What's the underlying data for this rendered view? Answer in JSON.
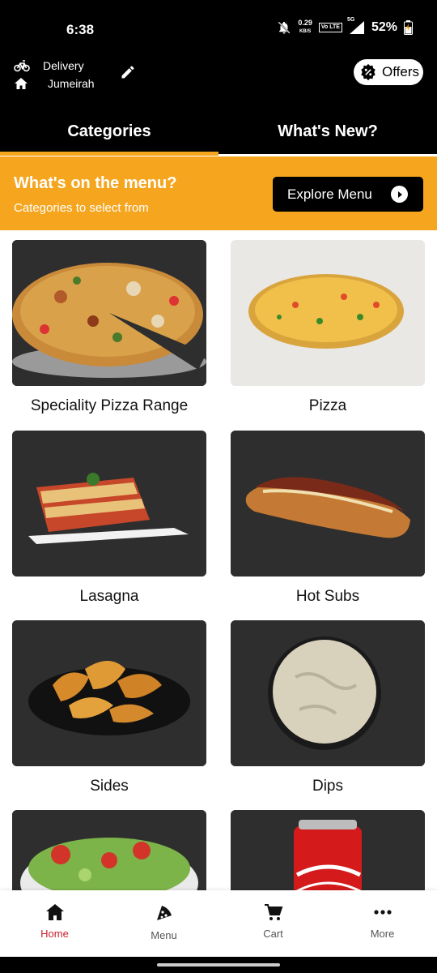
{
  "status_bar": {
    "time": "6:38",
    "speed_value": "0.29",
    "speed_unit": "KB/S",
    "network": "Vo LTE",
    "signal": "5G",
    "battery": "52%"
  },
  "header": {
    "delivery_label": "Delivery",
    "location": "Jumeirah",
    "offers_label": "Offers"
  },
  "tabs": [
    {
      "label": "Categories",
      "active": true
    },
    {
      "label": "What's New?",
      "active": false
    }
  ],
  "banner": {
    "title": "What's on the menu?",
    "subtitle": "Categories to select from",
    "button_label": "Explore Menu"
  },
  "categories": [
    {
      "name": "Speciality Pizza Range",
      "icon": "pizza-image"
    },
    {
      "name": "Pizza",
      "icon": "pizza-image"
    },
    {
      "name": "Lasagna",
      "icon": "lasagna-image"
    },
    {
      "name": "Hot Subs",
      "icon": "sub-image"
    },
    {
      "name": "Sides",
      "icon": "potato-wedges-image"
    },
    {
      "name": "Dips",
      "icon": "dip-image"
    },
    {
      "name": "",
      "icon": "salad-image"
    },
    {
      "name": "",
      "icon": "cola-can-image"
    }
  ],
  "bottom_nav": [
    {
      "label": "Home",
      "icon": "home-icon",
      "active": true
    },
    {
      "label": "Menu",
      "icon": "pizza-slice-icon",
      "active": false
    },
    {
      "label": "Cart",
      "icon": "cart-icon",
      "active": false
    },
    {
      "label": "More",
      "icon": "more-dots-icon",
      "active": false
    }
  ],
  "colors": {
    "accent": "#F5A51E",
    "header_bg": "#000000",
    "active_nav": "#C8202B"
  }
}
